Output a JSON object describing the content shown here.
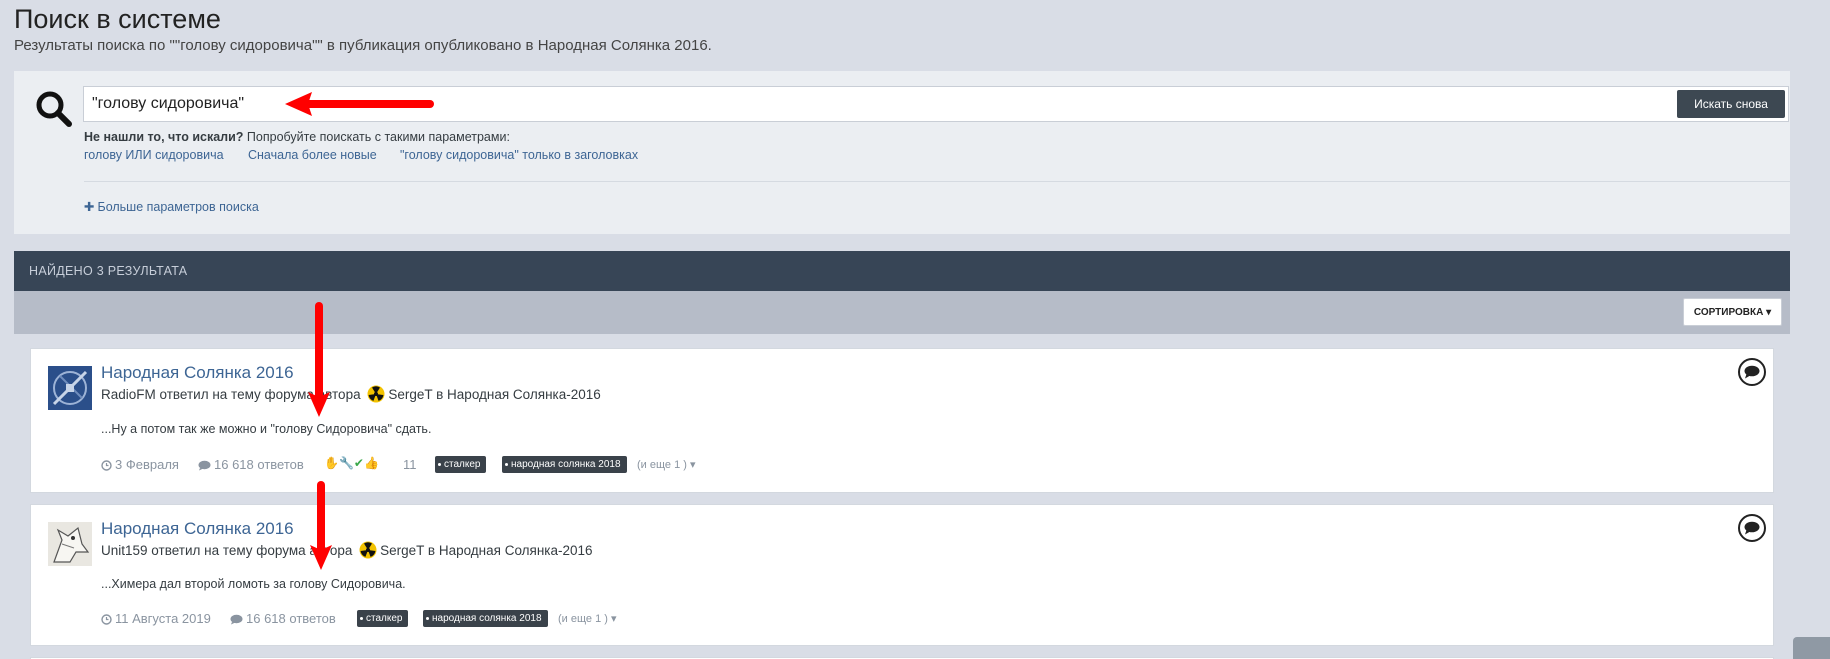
{
  "header": {
    "title": "Поиск в системе",
    "subtitle": "Результаты поиска по \"\"голову сидоровича\"\" в публикация опубликовано в Народная Солянка 2016."
  },
  "search": {
    "value": "\"голову сидоровича\"",
    "button_label": "Искать снова",
    "hint_bold": "Не нашли то, что искали?",
    "hint_text": " Попробуйте поискать с такими параметрами:",
    "suggestions": [
      "голову ИЛИ сидоровича",
      "Сначала более новые",
      "\"голову сидоровича\" только в заголовках"
    ],
    "more_params": "Больше параметров поиска"
  },
  "results": {
    "count_label": "НАЙДЕНО 3 РЕЗУЛЬТАТА",
    "sort_label": "СОРТИРОВКА"
  },
  "items": [
    {
      "title": "Народная Солянка 2016",
      "user": "RadioFM",
      "action": " ответил на тему форума автора ",
      "author": "SergeT",
      "in_text": " в Народная Солянка-2016",
      "snippet": "...Ну а потом так же можно и \"голову Сидоровича\" сдать.",
      "date": "3 Февраля",
      "replies": "16 618 ответов",
      "reaction_count": "11",
      "tags": [
        "сталкер",
        "народная солянка 2018"
      ],
      "more_tags": "(и еще 1 )"
    },
    {
      "title": "Народная Солянка 2016",
      "user": "Unit159",
      "action": " ответил на тему форума автора ",
      "author": "SergeT",
      "in_text": " в Народная Солянка-2016",
      "snippet": "...Химера дал второй ломоть за голову Сидоровича.",
      "date": "11 Августа 2019",
      "replies": "16 618 ответов",
      "tags": [
        "сталкер",
        "народная солянка 2018"
      ],
      "more_tags": "(и еще 1 )"
    }
  ],
  "colors": {
    "background": "#d9dde6",
    "link": "#3d6594",
    "dark_bar": "#374556",
    "annotation_arrow": "#ff0000"
  }
}
